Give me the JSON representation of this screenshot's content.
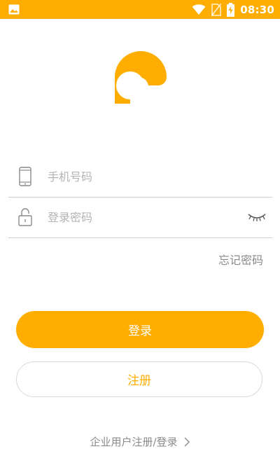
{
  "status_bar": {
    "time": "08:30",
    "icons": [
      "image-icon",
      "wifi-icon",
      "no-sim-icon",
      "battery-charging-icon"
    ]
  },
  "logo": {
    "icon": "brand-logo"
  },
  "form": {
    "phone_placeholder": "手机号码",
    "phone_icon": "phone-icon",
    "password_placeholder": "登录密码",
    "password_icon": "lock-icon",
    "toggle_icon": "eye-closed-icon",
    "forgot_label": "忘记密码"
  },
  "buttons": {
    "login_label": "登录",
    "register_label": "注册"
  },
  "footer": {
    "enterprise_label": "企业用户注册/登录",
    "chevron_icon": "chevron-right-icon"
  },
  "colors": {
    "accent": "#FFAD00",
    "muted_text": "#8a8a8a",
    "placeholder": "#b4b4b4",
    "divider": "#cfcfcf"
  }
}
